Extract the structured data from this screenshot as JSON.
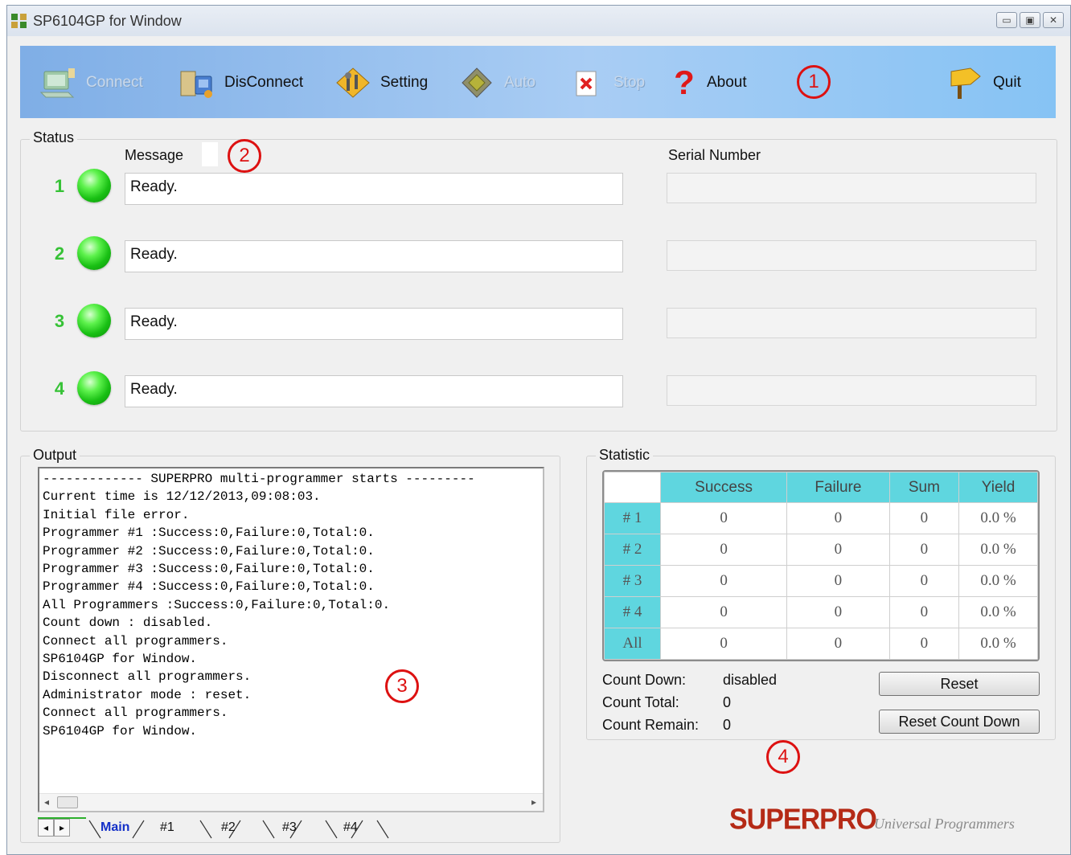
{
  "window": {
    "title": "SP6104GP for Window"
  },
  "toolbar": {
    "connect": "Connect",
    "disconnect": "DisConnect",
    "setting": "Setting",
    "auto": "Auto",
    "stop": "Stop",
    "about": "About",
    "quit": "Quit"
  },
  "callouts": [
    "1",
    "2",
    "3",
    "4"
  ],
  "status": {
    "title": "Status",
    "message_header": "Message",
    "serial_header": "Serial Number",
    "rows": [
      {
        "num": "1",
        "message": "Ready.",
        "serial": "",
        "led": "green"
      },
      {
        "num": "2",
        "message": "Ready.",
        "serial": "",
        "led": "green"
      },
      {
        "num": "3",
        "message": "Ready.",
        "serial": "",
        "led": "green"
      },
      {
        "num": "4",
        "message": "Ready.",
        "serial": "",
        "led": "green"
      }
    ]
  },
  "output": {
    "title": "Output",
    "lines": [
      "------------- SUPERPRO multi-programmer starts ---------",
      "Current time is 12/12/2013,09:08:03.",
      "Initial file error.",
      "Programmer #1 :Success:0,Failure:0,Total:0.",
      "Programmer #2 :Success:0,Failure:0,Total:0.",
      "Programmer #3 :Success:0,Failure:0,Total:0.",
      "Programmer #4 :Success:0,Failure:0,Total:0.",
      "All Programmers :Success:0,Failure:0,Total:0.",
      "Count down : disabled.",
      "Connect all programmers.",
      "SP6104GP for Window.",
      "Disconnect all programmers.",
      "Administrator mode : reset.",
      "Connect all programmers.",
      "SP6104GP for Window."
    ],
    "tabs": [
      "Main",
      "#1",
      "#2",
      "#3",
      "#4"
    ],
    "active_tab": "Main"
  },
  "statistic": {
    "title": "Statistic",
    "columns": [
      "Success",
      "Failure",
      "Sum",
      "Yield"
    ],
    "rows": [
      {
        "label": "# 1",
        "values": [
          "0",
          "0",
          "0",
          "0.0 %"
        ]
      },
      {
        "label": "# 2",
        "values": [
          "0",
          "0",
          "0",
          "0.0 %"
        ]
      },
      {
        "label": "# 3",
        "values": [
          "0",
          "0",
          "0",
          "0.0 %"
        ]
      },
      {
        "label": "# 4",
        "values": [
          "0",
          "0",
          "0",
          "0.0 %"
        ]
      },
      {
        "label": "All",
        "values": [
          "0",
          "0",
          "0",
          "0.0 %"
        ]
      }
    ],
    "count_down_label": "Count Down:",
    "count_down_value": "disabled",
    "count_total_label": "Count Total:",
    "count_total_value": "0",
    "count_remain_label": "Count Remain:",
    "count_remain_value": "0",
    "reset_button": "Reset",
    "reset_count_down_button": "Reset Count Down"
  },
  "branding": {
    "logo": "SUPERPRO",
    "tagline": "Universal Programmers"
  },
  "colors": {
    "toolbar_blue": "#a9cdf4",
    "led_green": "#19c014",
    "table_header": "#5fd6df",
    "callout_red": "#d11111",
    "logo_red": "#b52a16"
  }
}
